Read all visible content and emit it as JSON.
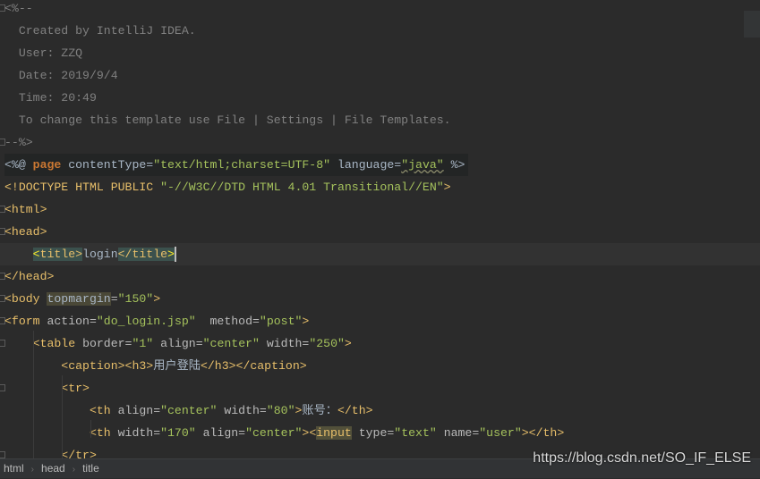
{
  "editor": {
    "lines": [
      [
        [
          "<%--",
          "comment"
        ]
      ],
      [
        [
          "  Created by IntelliJ IDEA.",
          "comment"
        ]
      ],
      [
        [
          "  User: ZZQ",
          "comment"
        ]
      ],
      [
        [
          "  Date: 2019/9/4",
          "comment"
        ]
      ],
      [
        [
          "  Time: 20:49",
          "comment"
        ]
      ],
      [
        [
          "  To change this template use File | Settings | File Templates.",
          "comment"
        ]
      ],
      [
        [
          "--%>",
          "comment"
        ]
      ],
      [
        [
          "<%@ ",
          "dir"
        ],
        [
          "page",
          "kw"
        ],
        [
          " contentType=",
          "dir"
        ],
        [
          "\"text/html;charset=UTF-8\"",
          "val"
        ],
        [
          " language=",
          "dir"
        ],
        [
          "\"java\"",
          "wavy"
        ],
        [
          " %>",
          "dir"
        ]
      ],
      [
        [
          "<!DOCTYPE HTML PUBLIC ",
          "doctype"
        ],
        [
          "\"-//W3C//DTD HTML 4.01 Transitional//EN\"",
          "docval"
        ],
        [
          ">",
          "doctype"
        ]
      ],
      [
        [
          "<html>",
          "tag"
        ]
      ],
      [
        [
          "<head>",
          "tag"
        ]
      ],
      [
        [
          "    ",
          "text"
        ],
        [
          "<",
          "matchy"
        ],
        [
          "title>",
          "match"
        ],
        [
          "login",
          "text"
        ],
        [
          "</title",
          "match"
        ],
        [
          ">",
          "matchy"
        ]
      ],
      [
        [
          "</head>",
          "tag"
        ]
      ],
      [
        [
          "<body ",
          "tag"
        ],
        [
          "topmargin",
          "warn"
        ],
        [
          "=",
          "attr"
        ],
        [
          "\"150\"",
          "val"
        ],
        [
          ">",
          "tag"
        ]
      ],
      [
        [
          "<form ",
          "tag"
        ],
        [
          "action=",
          "attr"
        ],
        [
          "\"do_login.jsp\"",
          "val"
        ],
        [
          "  method=",
          "attr"
        ],
        [
          "\"post\"",
          "val"
        ],
        [
          ">",
          "tag"
        ]
      ],
      [
        [
          "    <table ",
          "tag"
        ],
        [
          "border=",
          "attr"
        ],
        [
          "\"1\"",
          "val"
        ],
        [
          " align=",
          "attr"
        ],
        [
          "\"center\"",
          "val"
        ],
        [
          " width=",
          "attr"
        ],
        [
          "\"250\"",
          "val"
        ],
        [
          ">",
          "tag"
        ]
      ],
      [
        [
          "        <caption><h3>",
          "tag"
        ],
        [
          "用户登陆",
          "text"
        ],
        [
          "</h3></caption>",
          "tag"
        ]
      ],
      [
        [
          "        <tr>",
          "tag"
        ]
      ],
      [
        [
          "            <th ",
          "tag"
        ],
        [
          "align=",
          "attr"
        ],
        [
          "\"center\"",
          "val"
        ],
        [
          " width=",
          "attr"
        ],
        [
          "\"80\"",
          "val"
        ],
        [
          ">",
          "tag"
        ],
        [
          "账号：",
          "text"
        ],
        [
          "</th>",
          "tag"
        ]
      ],
      [
        [
          "            <th ",
          "tag"
        ],
        [
          "width=",
          "attr"
        ],
        [
          "\"170\"",
          "val"
        ],
        [
          " align=",
          "attr"
        ],
        [
          "\"center\"",
          "val"
        ],
        [
          "><",
          "tag"
        ],
        [
          "input",
          "hl"
        ],
        [
          " type=",
          "attr"
        ],
        [
          "\"text\"",
          "val"
        ],
        [
          " name=",
          "attr"
        ],
        [
          "\"user\"",
          "val"
        ],
        [
          "></th>",
          "tag"
        ]
      ],
      [
        [
          "        </tr>",
          "tag"
        ]
      ]
    ],
    "current_line": 11
  },
  "breadcrumb": [
    "html",
    "head",
    "title"
  ],
  "watermark": "https://blog.csdn.net/SO_IF_ELSE"
}
